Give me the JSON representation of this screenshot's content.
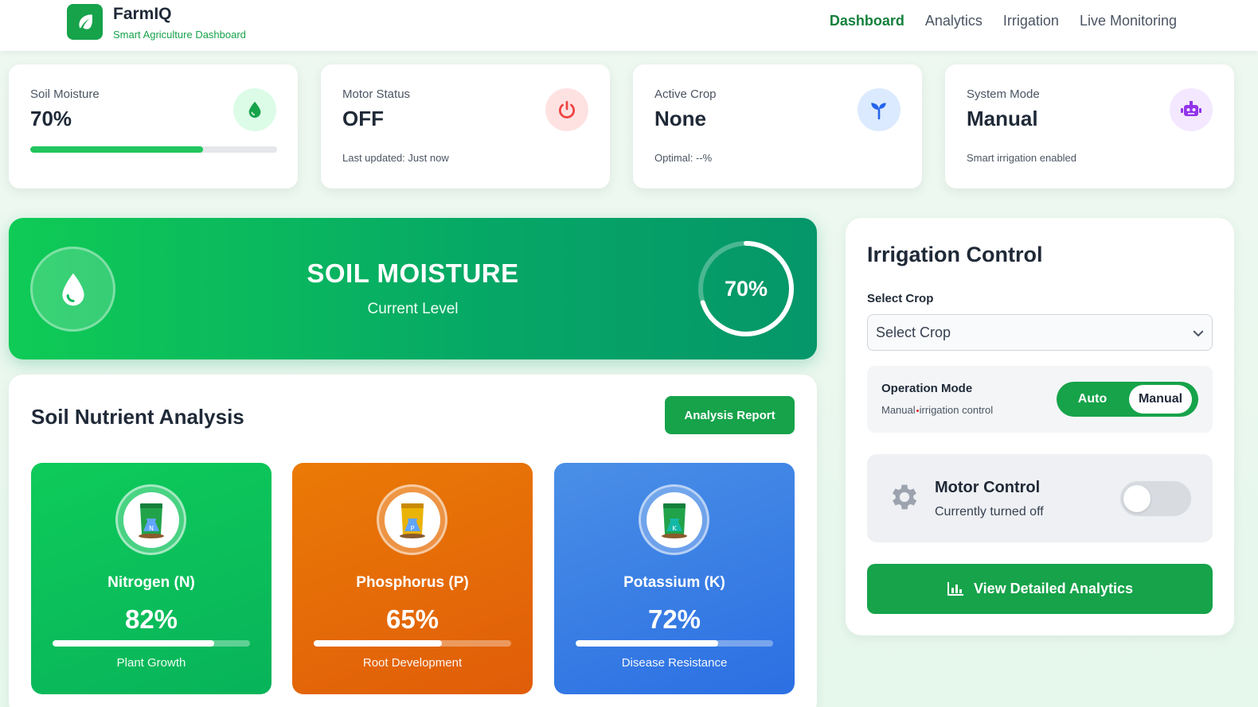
{
  "brand": {
    "name": "FarmIQ",
    "subtitle": "Smart Agriculture Dashboard"
  },
  "nav": [
    "Dashboard",
    "Analytics",
    "Irrigation",
    "Live Monitoring"
  ],
  "nav_active": "Dashboard",
  "stats": [
    {
      "label": "Soil Moisture",
      "value": "70%",
      "progress": 0.7,
      "icon": "water-drop-icon",
      "icon_color": "#16a34a",
      "icon_bg": "#dcfce7"
    },
    {
      "label": "Motor Status",
      "value": "OFF",
      "sub": "Last updated: Just now",
      "icon": "power-icon",
      "icon_color": "#ef4444",
      "icon_bg": "#fee2e2"
    },
    {
      "label": "Active Crop",
      "value": "None",
      "sub": "Optimal: --%",
      "icon": "seedling-icon",
      "icon_color": "#2563eb",
      "icon_bg": "#dbeafe"
    },
    {
      "label": "System Mode",
      "value": "Manual",
      "sub": "Smart irrigation enabled",
      "icon": "robot-icon",
      "icon_color": "#9333ea",
      "icon_bg": "#f3e8ff"
    }
  ],
  "banner": {
    "title": "SOIL MOISTURE",
    "subtitle": "Current Level",
    "value": "70%",
    "level": 0.7
  },
  "nutrients": {
    "title": "Soil Nutrient Analysis",
    "report_button": "Analysis Report",
    "items": [
      {
        "name": "Nitrogen (N)",
        "value": "82%",
        "level": 0.82,
        "sub": "Plant Growth",
        "letter": "N"
      },
      {
        "name": "Phosphorus (P)",
        "value": "65%",
        "level": 0.65,
        "sub": "Root Development",
        "letter": "P"
      },
      {
        "name": "Potassium (K)",
        "value": "72%",
        "level": 0.72,
        "sub": "Disease Resistance",
        "letter": "K"
      }
    ]
  },
  "irrigation": {
    "title": "Irrigation Control",
    "select_label": "Select Crop",
    "select_value": "Select Crop",
    "mode_title": "Operation Mode",
    "mode_sub_a": "Manual",
    "mode_sub_b": "irrigation control",
    "mode_auto": "Auto",
    "mode_manual": "Manual",
    "motor_title": "Motor Control",
    "motor_sub": "Currently turned off",
    "motor_on": false,
    "analytics_button": "View Detailed Analytics"
  },
  "colors": {
    "accent": "#16a34a",
    "accent_dark": "#15803d"
  }
}
